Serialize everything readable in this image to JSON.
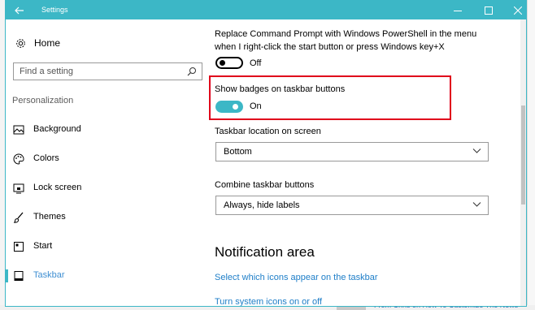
{
  "window": {
    "title": "Settings",
    "accent_color": "#3cb7c6"
  },
  "sidebar": {
    "home_label": "Home",
    "search_placeholder": "Find a setting",
    "section_header": "Personalization",
    "items": [
      {
        "label": "Background",
        "icon": "picture-icon"
      },
      {
        "label": "Colors",
        "icon": "palette-icon"
      },
      {
        "label": "Lock screen",
        "icon": "lock-screen-icon"
      },
      {
        "label": "Themes",
        "icon": "brush-icon"
      },
      {
        "label": "Start",
        "icon": "start-icon"
      },
      {
        "label": "Taskbar",
        "icon": "taskbar-icon",
        "active": true
      }
    ]
  },
  "content": {
    "powershell": {
      "line1": "Replace Command Prompt with Windows PowerShell in the menu",
      "line2": "when I right-click the start button or press Windows key+X",
      "state": "Off"
    },
    "badges": {
      "label": "Show badges on taskbar buttons",
      "state": "On"
    },
    "location": {
      "label": "Taskbar location on screen",
      "value": "Bottom"
    },
    "combine": {
      "label": "Combine taskbar buttons",
      "value": "Always, hide labels"
    },
    "notification": {
      "heading": "Notification area",
      "link1": "Select which icons appear on the taskbar",
      "link2": "Turn system icons on or off"
    }
  },
  "background": {
    "snippet": "From Chris on How To Customize The News"
  }
}
